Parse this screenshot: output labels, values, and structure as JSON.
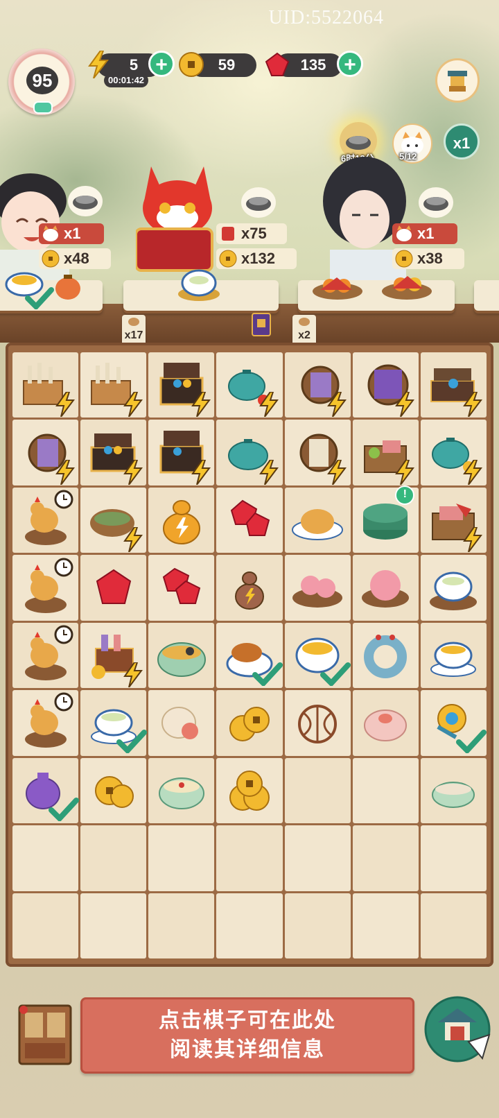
{
  "uid": "UID:5522064",
  "player_level": "95",
  "energy": {
    "value": "5",
    "timer": "00:01:42"
  },
  "coins": {
    "value": "59"
  },
  "gems": {
    "value": "135"
  },
  "event": {
    "timer": "6时13分",
    "progress": "5/12",
    "multiplier": "x1"
  },
  "customers": [
    {
      "name": "girl",
      "cat_label": "x1",
      "coin_label": "x48"
    },
    {
      "name": "red-fox",
      "order_label": "x75",
      "coin_label": "x132"
    },
    {
      "name": "scholar",
      "cat_label": "x1",
      "coin_label": "x38"
    }
  ],
  "shelf_notes": [
    {
      "label": "x17"
    },
    {
      "label": "x2"
    }
  ],
  "hint": {
    "line1": "点击棋子可在此处",
    "line2": "阅读其详细信息"
  },
  "colors": {
    "accent_green": "#35b87e",
    "hint_red": "#d86f5e",
    "board_brown": "#9c6a44"
  }
}
